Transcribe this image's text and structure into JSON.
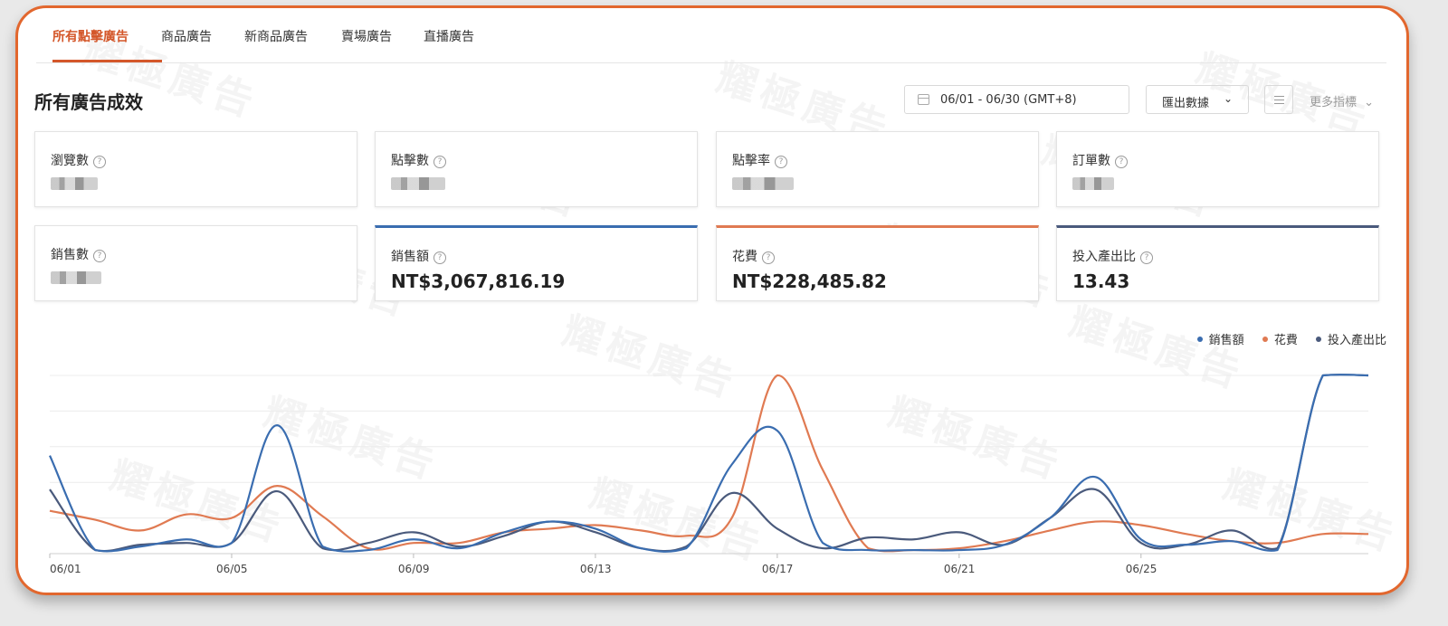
{
  "watermark": "耀極廣告",
  "tabs": [
    {
      "label": "所有點擊廣告",
      "active": true
    },
    {
      "label": "商品廣告"
    },
    {
      "label": "新商品廣告"
    },
    {
      "label": "賣場廣告"
    },
    {
      "label": "直播廣告"
    }
  ],
  "header": {
    "title": "所有廣告成效",
    "date_range": "06/01 - 06/30 (GMT+8)",
    "export_label": "匯出數據",
    "more_label": "更多指標"
  },
  "metrics": [
    {
      "label": "瀏覽數",
      "value": null,
      "hidden": true
    },
    {
      "label": "點擊數",
      "value": null,
      "hidden": true
    },
    {
      "label": "點擊率",
      "value": null,
      "hidden": true
    },
    {
      "label": "訂單數",
      "value": null,
      "hidden": true
    },
    {
      "label": "銷售數",
      "value": null,
      "hidden": true
    },
    {
      "label": "銷售額",
      "value": "NT$3,067,816.19",
      "selected": true,
      "color": "#3a6db0"
    },
    {
      "label": "花費",
      "value": "NT$228,485.82",
      "selected": true,
      "color": "#e07a52"
    },
    {
      "label": "投入產出比",
      "value": "13.43",
      "selected": true,
      "color": "#4a5a7c"
    }
  ],
  "chart_data": {
    "type": "line",
    "x": [
      "06/01",
      "06/02",
      "06/03",
      "06/04",
      "06/05",
      "06/06",
      "06/07",
      "06/08",
      "06/09",
      "06/10",
      "06/11",
      "06/12",
      "06/13",
      "06/14",
      "06/15",
      "06/16",
      "06/17",
      "06/18",
      "06/19",
      "06/20",
      "06/21",
      "06/22",
      "06/23",
      "06/24",
      "06/25",
      "06/26",
      "06/27",
      "06/28",
      "06/29",
      "06/30"
    ],
    "tick_labels": [
      "06/01",
      "06/05",
      "06/09",
      "06/13",
      "06/17",
      "06/21",
      "06/25"
    ],
    "grid": true,
    "legend_position": "top-right",
    "note": "y-axis unlabeled; values are relative levels 0-100",
    "ylim": [
      0,
      100
    ],
    "series": [
      {
        "name": "銷售額",
        "color": "#3a6db0",
        "values": [
          55,
          2,
          4,
          8,
          6,
          72,
          4,
          2,
          8,
          3,
          12,
          18,
          14,
          3,
          3,
          50,
          69,
          6,
          2,
          2,
          2,
          5,
          20,
          43,
          8,
          5,
          7,
          2,
          100,
          100
        ]
      },
      {
        "name": "花費",
        "color": "#e07a52",
        "values": [
          24,
          19,
          13,
          22,
          20,
          38,
          21,
          3,
          6,
          6,
          12,
          14,
          16,
          13,
          10,
          20,
          100,
          47,
          3,
          2,
          3,
          7,
          13,
          18,
          16,
          11,
          7,
          6,
          11,
          11
        ]
      },
      {
        "name": "投入產出比",
        "color": "#4a5a7c",
        "values": [
          36,
          2,
          5,
          6,
          6,
          35,
          3,
          6,
          12,
          4,
          10,
          18,
          12,
          3,
          4,
          34,
          14,
          3,
          9,
          8,
          12,
          5,
          20,
          36,
          6,
          5,
          13,
          3,
          100,
          100
        ]
      }
    ]
  }
}
